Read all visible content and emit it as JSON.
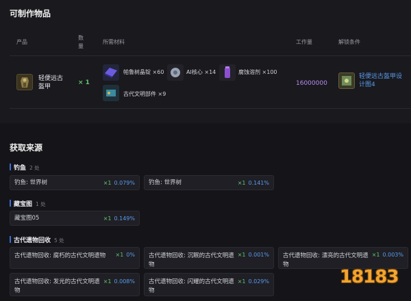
{
  "craftable": {
    "title": "可制作物品",
    "headers": {
      "product": "产品",
      "qty": "数量",
      "materials": "所需材料",
      "work": "工作量",
      "unlock": "解锁条件"
    },
    "row": {
      "product_name": "轻便远古盔甲",
      "product_qty": "× 1",
      "materials": [
        {
          "name": "帕鲁树晶锭",
          "qty": "×60",
          "icon": "crystal-ingot-icon"
        },
        {
          "name": "AI核心",
          "qty": "×14",
          "icon": "ai-core-icon"
        },
        {
          "name": "腐蚀溶剂",
          "qty": "×100",
          "icon": "corrosive-solvent-icon"
        },
        {
          "name": "古代文明部件",
          "qty": "×9",
          "icon": "ancient-part-icon"
        }
      ],
      "work": "16000000",
      "unlock": "轻便远古盔甲设计图4"
    }
  },
  "sources": {
    "title": "获取来源",
    "groups": [
      {
        "name": "钓鱼",
        "count": "2 处",
        "items": [
          {
            "name": "钓鱼: 世界树",
            "qty": "×1",
            "pct": "0.079%"
          },
          {
            "name": "钓鱼: 世界树",
            "qty": "×1",
            "pct": "0.141%"
          }
        ]
      },
      {
        "name": "藏宝图",
        "count": "1 处",
        "items": [
          {
            "name": "藏宝图05",
            "qty": "×1",
            "pct": "0.149%"
          }
        ]
      },
      {
        "name": "古代遗物回收",
        "count": "5 处",
        "items": [
          {
            "name": "古代遗物回收: 腐朽的古代文明遗物",
            "qty": "×1",
            "pct": "0%"
          },
          {
            "name": "古代遗物回收: 沉眠的古代文明遗物",
            "qty": "×1",
            "pct": "0.001%"
          },
          {
            "name": "古代遗物回收: 漂亮的古代文明遗物",
            "qty": "×1",
            "pct": "0.003%"
          },
          {
            "name": "古代遗物回收: 发光的古代文明遗物",
            "qty": "×1",
            "pct": "0.008%"
          },
          {
            "name": "古代遗物回收: 闪耀的古代文明遗物",
            "qty": "×1",
            "pct": "0.029%"
          }
        ]
      }
    ]
  },
  "watermark": "18183",
  "colors": {
    "accent": "#5a9bea",
    "green": "#63c76b",
    "bar": "#3b6fd8"
  }
}
